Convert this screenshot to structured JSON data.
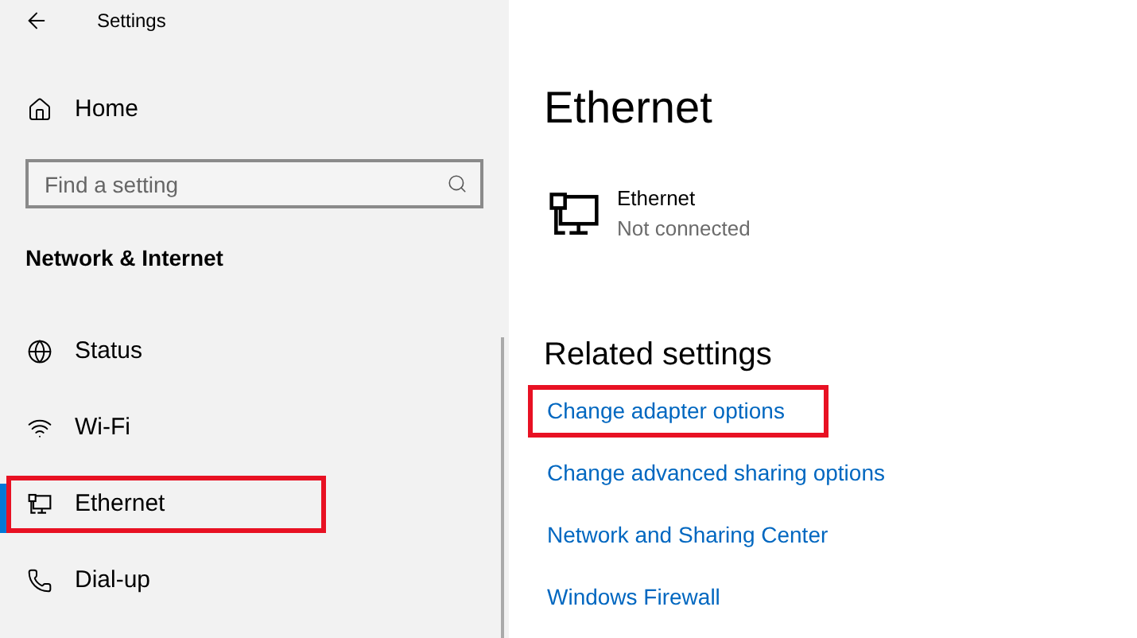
{
  "window": {
    "title": "Settings"
  },
  "sidebar": {
    "home": "Home",
    "search": {
      "placeholder": "Find a setting"
    },
    "section": "Network & Internet",
    "items": [
      {
        "kind": "status",
        "label": "Status",
        "selected": false,
        "highlighted": false
      },
      {
        "kind": "wifi",
        "label": "Wi-Fi",
        "selected": false,
        "highlighted": false
      },
      {
        "kind": "ethernet",
        "label": "Ethernet",
        "selected": true,
        "highlighted": true
      },
      {
        "kind": "dialup",
        "label": "Dial-up",
        "selected": false,
        "highlighted": false
      }
    ]
  },
  "page": {
    "title": "Ethernet",
    "adapter": {
      "name": "Ethernet",
      "status": "Not connected"
    },
    "related": {
      "heading": "Related settings",
      "links": [
        {
          "label": "Change adapter options",
          "highlighted": true
        },
        {
          "label": "Change advanced sharing options",
          "highlighted": false
        },
        {
          "label": "Network and Sharing Center",
          "highlighted": false
        },
        {
          "label": "Windows Firewall",
          "highlighted": false
        }
      ]
    }
  }
}
